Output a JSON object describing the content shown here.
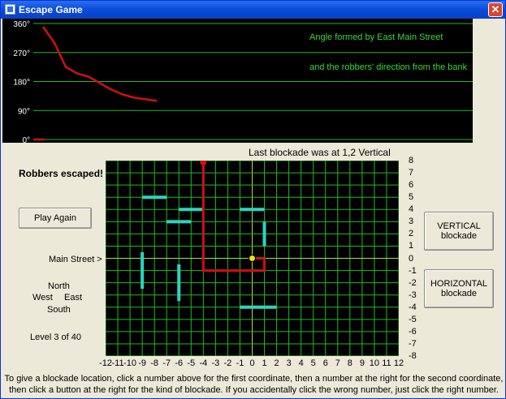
{
  "window": {
    "title": "Escape Game",
    "close_glyph": "✕",
    "icon": "app-icon"
  },
  "angle_chart": {
    "y_ticks": [
      "360°",
      "270°",
      "180°",
      "90°",
      "0°"
    ],
    "annotation_line1": "Angle formed by East Main Street",
    "annotation_line2": "and the robbers' direction from the bank",
    "angle_values_deg": [
      350,
      300,
      225,
      205,
      195,
      175,
      155,
      140,
      130,
      125,
      120
    ]
  },
  "last_blockade": "Last blockade was at 1,2 Vertical",
  "status": "Robbers escaped!",
  "play_again": "Play Again",
  "main_street_label": "Main Street >",
  "compass": {
    "north": "North",
    "west": "West",
    "east": "East",
    "south": "South"
  },
  "level": "Level 3 of 40",
  "buttons": {
    "vertical": [
      "VERTICAL",
      "blockade"
    ],
    "horizontal": [
      "HORIZONTAL",
      "blockade"
    ]
  },
  "x_numbers": [
    "-12",
    "-11",
    "-10",
    "-9",
    "-8",
    "-7",
    "-6",
    "-5",
    "-4",
    "-3",
    "-2",
    "-1",
    "0",
    "1",
    "2",
    "3",
    "4",
    "5",
    "6",
    "7",
    "8",
    "9",
    "10",
    "11",
    "12"
  ],
  "y_numbers": [
    "8",
    "7",
    "6",
    "5",
    "4",
    "3",
    "2",
    "1",
    "0",
    "-1",
    "-2",
    "-3",
    "-4",
    "-5",
    "-6",
    "-7",
    "-8"
  ],
  "blockades": [
    {
      "type": "horizontal",
      "x1": -9,
      "x2": -7,
      "y": 5
    },
    {
      "type": "horizontal",
      "x1": -6,
      "x2": -4,
      "y": 4
    },
    {
      "type": "horizontal",
      "x1": -7,
      "x2": -5,
      "y": 3
    },
    {
      "type": "horizontal",
      "x1": -1,
      "x2": 1,
      "y": 4
    },
    {
      "type": "vertical",
      "x": 1,
      "y1": 3,
      "y2": 1
    },
    {
      "type": "vertical",
      "x": -9,
      "y1": 0.5,
      "y2": -2.5
    },
    {
      "type": "vertical",
      "x": -6,
      "y1": -0.5,
      "y2": -3.5
    },
    {
      "type": "horizontal",
      "x1": -1,
      "x2": 2,
      "y": -4
    }
  ],
  "robber_path": [
    [
      0,
      0
    ],
    [
      1,
      0
    ],
    [
      1,
      -1
    ],
    [
      -4,
      -1
    ],
    [
      -4,
      8
    ]
  ],
  "colors": {
    "grid": "#25b825",
    "axis": "#a8e04a",
    "path": "#d01010",
    "blockade": "#2ad6c0",
    "bank": "#f0e010"
  },
  "help_text": [
    "To give a blockade location, click a number above for the first coordinate, then a number at the right for the second coordinate,",
    "then click a button at the right for the kind of blockade. If you accidentally click the wrong number, just click the right number."
  ]
}
